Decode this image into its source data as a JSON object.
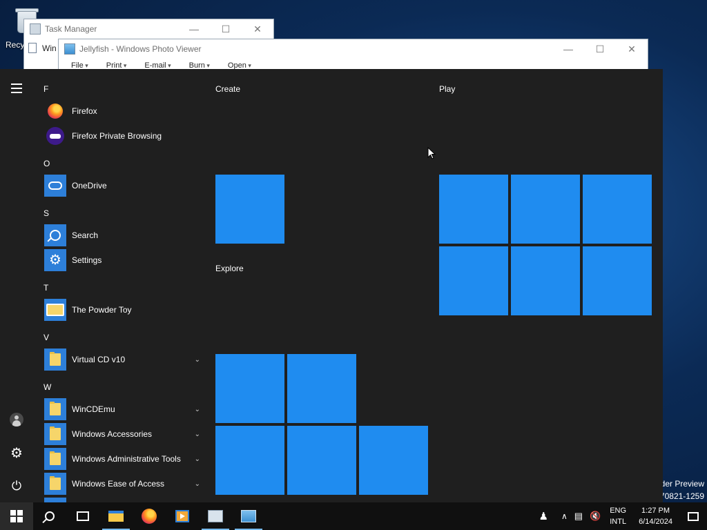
{
  "desktop": {
    "recycle_label": "Recy",
    "watermark_line1": "der Preview",
    "watermark_line2": "70821-1259"
  },
  "windows": {
    "task_manager": {
      "title": "Task Manager",
      "row_label": "Win"
    },
    "photo_viewer": {
      "title": "Jellyfish - Windows Photo Viewer",
      "menu": [
        "File",
        "Print",
        "E-mail",
        "Burn",
        "Open"
      ]
    }
  },
  "start_menu": {
    "apps": [
      {
        "type": "letter",
        "text": "F"
      },
      {
        "type": "app",
        "name": "Firefox",
        "icon": "firefox-icon"
      },
      {
        "type": "app",
        "name": "Firefox Private Browsing",
        "icon": "firefox-private-icon"
      },
      {
        "type": "letter",
        "text": "O"
      },
      {
        "type": "app",
        "name": "OneDrive",
        "icon": "onedrive-icon"
      },
      {
        "type": "letter",
        "text": "S"
      },
      {
        "type": "app",
        "name": "Search",
        "icon": "search-icon"
      },
      {
        "type": "app",
        "name": "Settings",
        "icon": "gear-icon"
      },
      {
        "type": "letter",
        "text": "T"
      },
      {
        "type": "app",
        "name": "The Powder Toy",
        "icon": "powder-toy-icon"
      },
      {
        "type": "letter",
        "text": "V"
      },
      {
        "type": "app",
        "name": "Virtual CD v10",
        "icon": "folder-icon",
        "expandable": true
      },
      {
        "type": "letter",
        "text": "W"
      },
      {
        "type": "app",
        "name": "WinCDEmu",
        "icon": "folder-icon",
        "expandable": true
      },
      {
        "type": "app",
        "name": "Windows Accessories",
        "icon": "folder-icon",
        "expandable": true
      },
      {
        "type": "app",
        "name": "Windows Administrative Tools",
        "icon": "folder-icon",
        "expandable": true
      },
      {
        "type": "app",
        "name": "Windows Ease of Access",
        "icon": "folder-icon",
        "expandable": true
      }
    ],
    "groups": {
      "create": "Create",
      "play": "Play",
      "explore": "Explore"
    }
  },
  "taskbar": {
    "language_line1": "ENG",
    "language_line2": "INTL",
    "time": "1:27 PM",
    "date": "6/14/2024",
    "tray_chevron": "∧",
    "accent": "#1f8cf0"
  }
}
